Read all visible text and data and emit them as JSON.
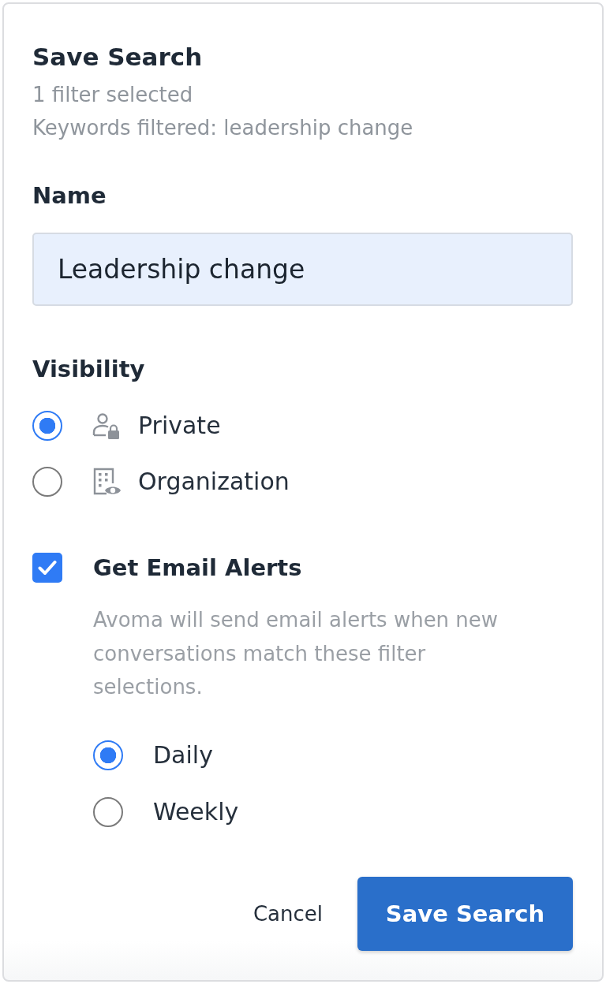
{
  "dialog": {
    "title": "Save Search",
    "filter_count": "1 filter selected",
    "filter_summary": "Keywords filtered: leadership change"
  },
  "name_field": {
    "label": "Name",
    "value": "Leadership change"
  },
  "visibility": {
    "label": "Visibility",
    "options": [
      {
        "label": "Private",
        "kind": "person-lock",
        "selected": true
      },
      {
        "label": "Organization",
        "kind": "building-eye",
        "selected": false
      }
    ]
  },
  "email_alerts": {
    "label": "Get Email Alerts",
    "checked": true,
    "description": "Avoma will send email alerts when new conversations match these filter selections.",
    "frequencies": [
      {
        "label": "Daily",
        "selected": true
      },
      {
        "label": "Weekly",
        "selected": false
      }
    ]
  },
  "buttons": [
    {
      "label": "Cancel",
      "kind": "text"
    },
    {
      "label": "Save Search",
      "kind": "primary"
    }
  ]
}
